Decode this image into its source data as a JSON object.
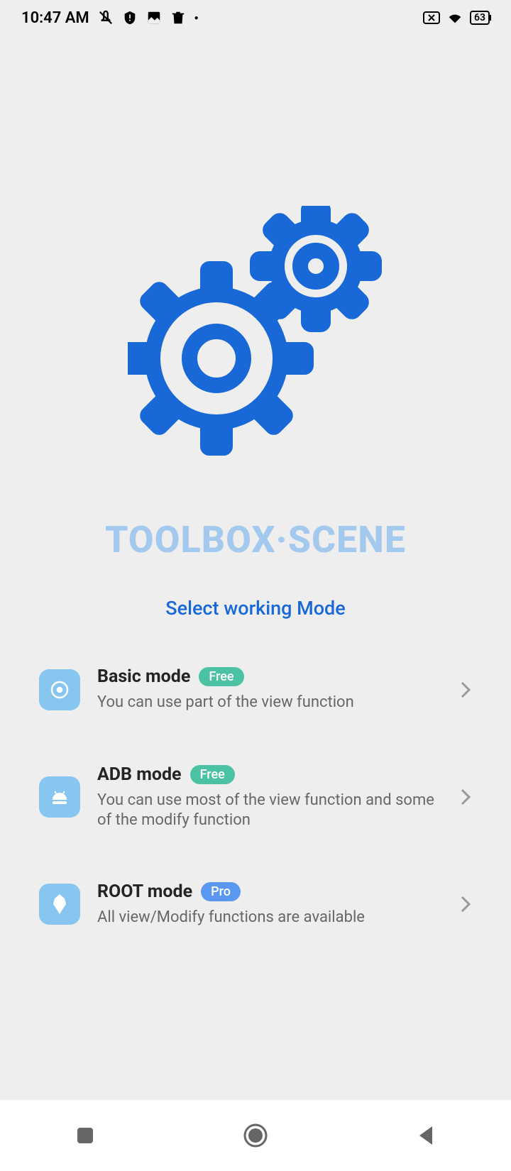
{
  "status_bar": {
    "time": "10:47 AM",
    "battery": "63"
  },
  "hero": {
    "title": "TOOLBOX·SCENE",
    "subtitle": "Select working Mode"
  },
  "modes": [
    {
      "title": "Basic mode",
      "badge": "Free",
      "badge_type": "free",
      "description": "You can use part of the view function"
    },
    {
      "title": "ADB mode",
      "badge": "Free",
      "badge_type": "free",
      "description": "You can use most of the view function and some of the modify function"
    },
    {
      "title": "ROOT mode",
      "badge": "Pro",
      "badge_type": "pro",
      "description": "All view/Modify functions are available"
    }
  ]
}
